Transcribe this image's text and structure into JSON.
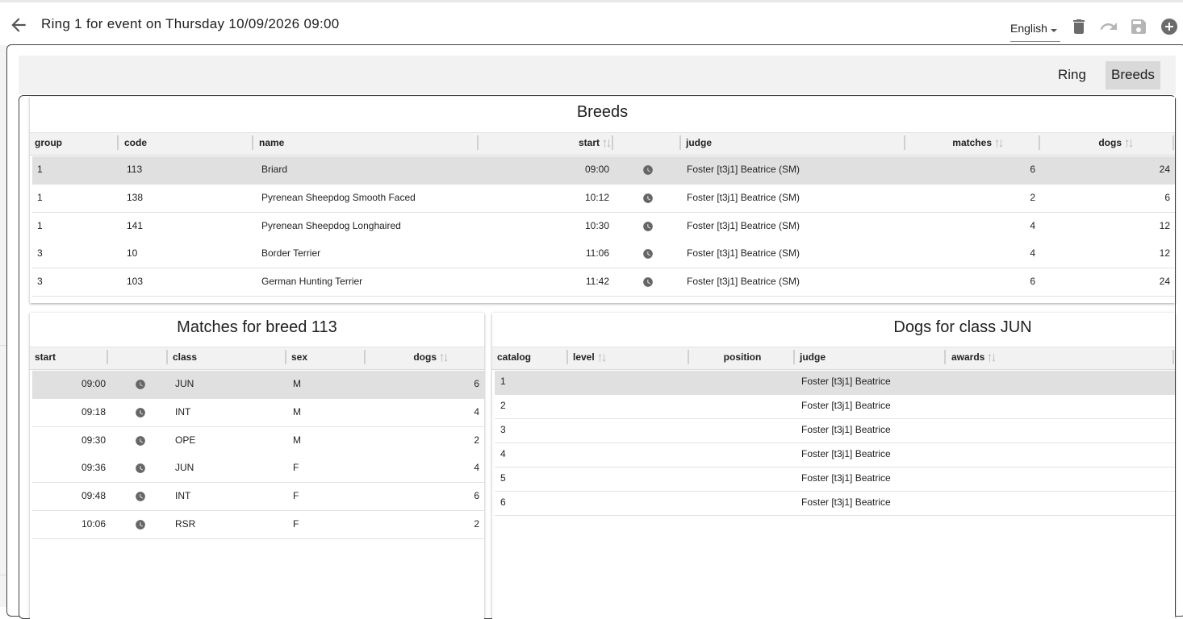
{
  "header": {
    "title": "Ring 1 for event on Thursday 10/09/2026 09:00",
    "language": "English"
  },
  "toolbar_icons": [
    "arrow-back-icon",
    "trash-icon",
    "undo-icon",
    "save-icon",
    "add-circle-icon"
  ],
  "tabs": [
    {
      "label": "Ring",
      "active": false
    },
    {
      "label": "Breeds",
      "active": true
    }
  ],
  "breeds": {
    "title": "Breeds",
    "columns": {
      "group": "group",
      "code": "code",
      "name": "name",
      "start": "start",
      "judge": "judge",
      "matches": "matches",
      "dogs": "dogs"
    },
    "rows": [
      {
        "group": "1",
        "code": "113",
        "name": "Briard",
        "start": "09:00",
        "judge": "Foster [t3j1] Beatrice (SM)",
        "matches": "6",
        "dogs": "24"
      },
      {
        "group": "1",
        "code": "138",
        "name": "Pyrenean Sheepdog Smooth Faced",
        "start": "10:12",
        "judge": "Foster [t3j1] Beatrice (SM)",
        "matches": "2",
        "dogs": "6"
      },
      {
        "group": "1",
        "code": "141",
        "name": "Pyrenean Sheepdog Longhaired",
        "start": "10:30",
        "judge": "Foster [t3j1] Beatrice (SM)",
        "matches": "4",
        "dogs": "12"
      },
      {
        "group": "3",
        "code": "10",
        "name": "Border Terrier",
        "start": "11:06",
        "judge": "Foster [t3j1] Beatrice (SM)",
        "matches": "4",
        "dogs": "12"
      },
      {
        "group": "3",
        "code": "103",
        "name": "German Hunting Terrier",
        "start": "11:42",
        "judge": "Foster [t3j1] Beatrice (SM)",
        "matches": "6",
        "dogs": "24"
      }
    ]
  },
  "matches": {
    "title": "Matches for breed 113",
    "columns": {
      "start": "start",
      "class": "class",
      "sex": "sex",
      "dogs": "dogs"
    },
    "rows": [
      {
        "start": "09:00",
        "class": "JUN",
        "sex": "M",
        "dogs": "6"
      },
      {
        "start": "09:18",
        "class": "INT",
        "sex": "M",
        "dogs": "4"
      },
      {
        "start": "09:30",
        "class": "OPE",
        "sex": "M",
        "dogs": "2"
      },
      {
        "start": "09:36",
        "class": "JUN",
        "sex": "F",
        "dogs": "4"
      },
      {
        "start": "09:48",
        "class": "INT",
        "sex": "F",
        "dogs": "6"
      },
      {
        "start": "10:06",
        "class": "RSR",
        "sex": "F",
        "dogs": "2"
      }
    ]
  },
  "dogs": {
    "title": "Dogs for class JUN",
    "columns": {
      "catalog": "catalog",
      "level": "level",
      "position": "position",
      "judge": "judge",
      "awards": "awards"
    },
    "rows": [
      {
        "catalog": "1",
        "judge": "Foster [t3j1] Beatrice"
      },
      {
        "catalog": "2",
        "judge": "Foster [t3j1] Beatrice"
      },
      {
        "catalog": "3",
        "judge": "Foster [t3j1] Beatrice"
      },
      {
        "catalog": "4",
        "judge": "Foster [t3j1] Beatrice"
      },
      {
        "catalog": "5",
        "judge": "Foster [t3j1] Beatrice"
      },
      {
        "catalog": "6",
        "judge": "Foster [t3j1] Beatrice"
      }
    ]
  },
  "colors": {
    "icon": "#6b6b6b",
    "icon_disabled": "#b5b5b5",
    "header_bg": "#f2f2f2",
    "selected_row": "#e0e0e0"
  }
}
